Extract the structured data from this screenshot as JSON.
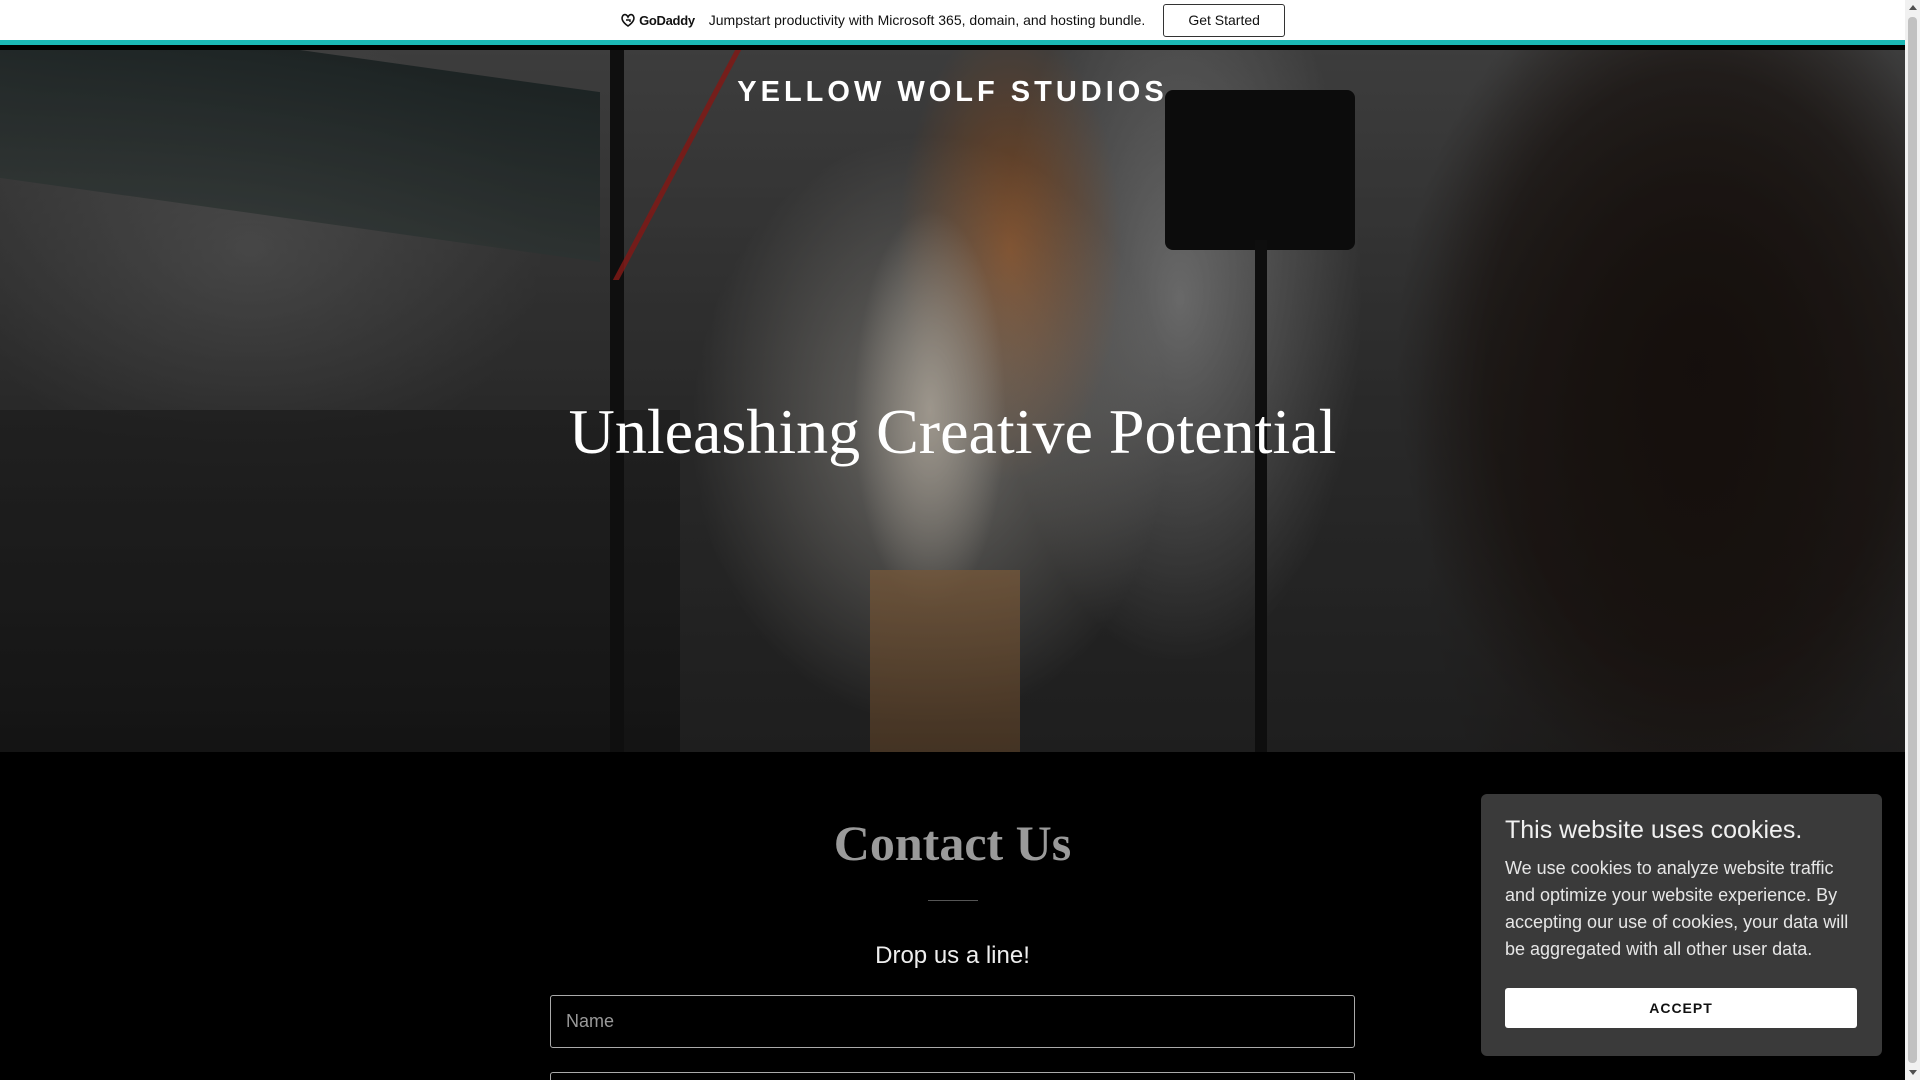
{
  "promo": {
    "logo_text": "GoDaddy",
    "message": "Jumpstart productivity with Microsoft 365, domain, and hosting bundle.",
    "cta_label": "Get Started",
    "accent_color": "#1bb7b5"
  },
  "hero": {
    "site_title": "YELLOW WOLF STUDIOS",
    "heading": "Unleashing Creative Potential"
  },
  "contact": {
    "title": "Contact Us",
    "subtitle": "Drop us a line!",
    "name_placeholder": "Name"
  },
  "cookie": {
    "title": "This website uses cookies.",
    "text": "We use cookies to analyze website traffic and optimize your website experience. By accepting our use of cookies, your data will be aggregated with all other user data.",
    "accept_label": "ACCEPT"
  },
  "icons": {
    "logo": "godaddy-logo-icon",
    "scroll_up": "chevron-up-icon",
    "scroll_down": "chevron-down-icon"
  }
}
